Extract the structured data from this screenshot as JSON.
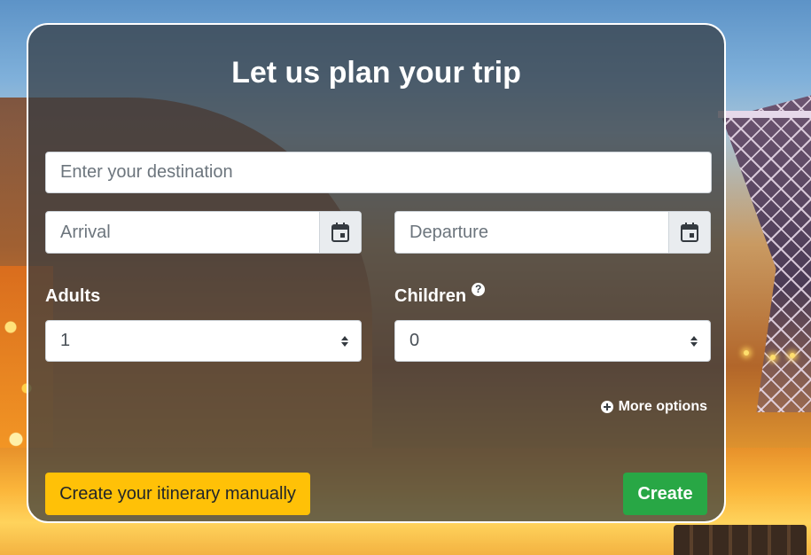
{
  "form": {
    "title": "Let us plan your trip",
    "destination_placeholder": "Enter your destination",
    "arrival_placeholder": "Arrival",
    "departure_placeholder": "Departure",
    "adults_label": "Adults",
    "adults_value": "1",
    "children_label": "Children",
    "children_value": "0",
    "help_glyph": "?",
    "more_options": "More options",
    "manual_button": "Create your itinerary manually",
    "create_button": "Create"
  },
  "icons": {
    "calendar": "calendar-icon",
    "help": "question-circle-icon",
    "more": "plus-circle-icon",
    "select": "sort-caret-icon"
  },
  "colors": {
    "card_overlay": "#343a40",
    "card_border": "#ffffff",
    "manual_button_bg": "#ffc107",
    "create_button_bg": "#28a745",
    "text_on_dark": "#ffffff"
  }
}
